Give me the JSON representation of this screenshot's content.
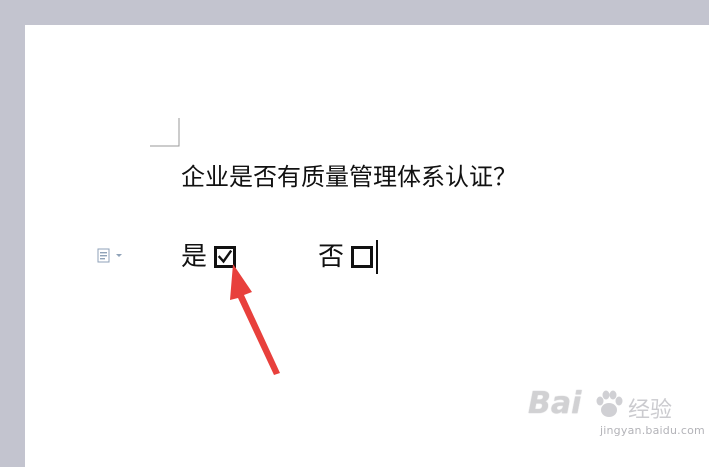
{
  "document": {
    "question": "企业是否有质量管理体系认证？",
    "options": [
      {
        "label": "是",
        "checked": true
      },
      {
        "label": "否",
        "checked": false
      }
    ]
  },
  "icons": {
    "paste_options": "paste-options-icon",
    "corner_mark": "page-corner-mark",
    "annotation": "red-arrow-annotation",
    "checkbox_checked": "checkbox-checked-icon",
    "checkbox_empty": "checkbox-empty-icon"
  },
  "colors": {
    "workspace_bg": "#c3c4cf",
    "page_bg": "#ffffff",
    "text": "#111111",
    "arrow": "#e8403c"
  },
  "watermark": {
    "brand": "Bai",
    "brand_suffix": "经验",
    "url": "jingyan.baidu.com"
  }
}
